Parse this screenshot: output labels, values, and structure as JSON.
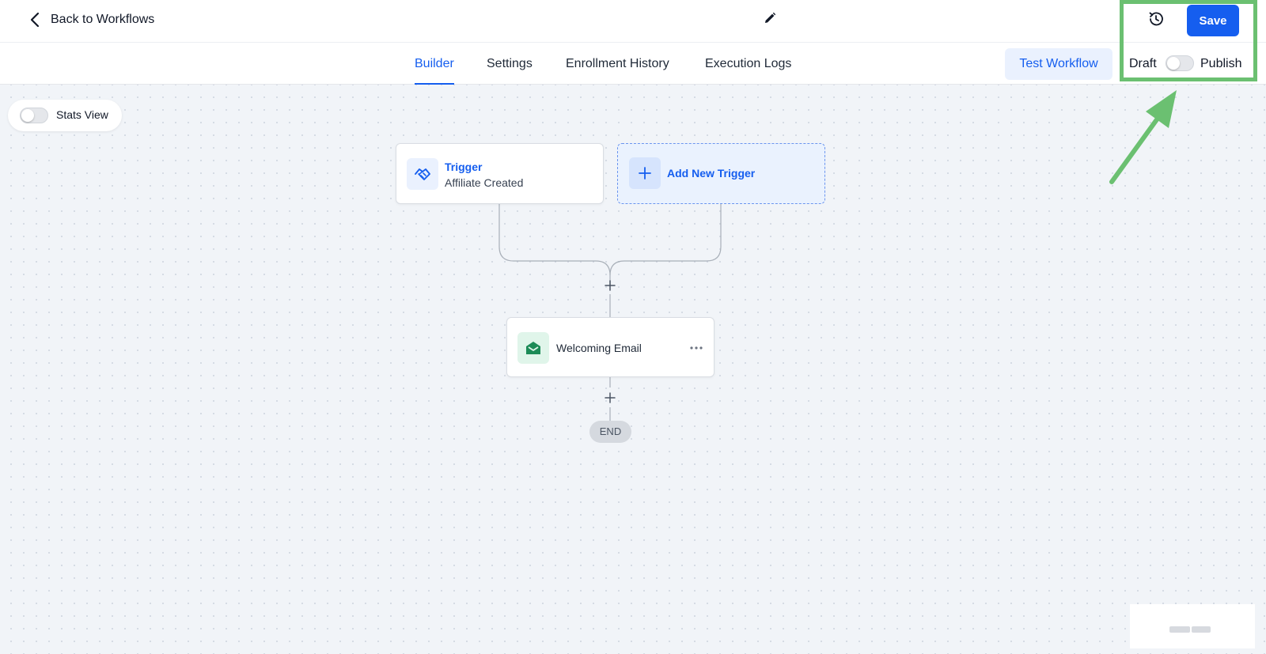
{
  "header": {
    "back_label": "Back to Workflows",
    "save_label": "Save"
  },
  "tabs": [
    {
      "label": "Builder",
      "active": true
    },
    {
      "label": "Settings",
      "active": false
    },
    {
      "label": "Enrollment History",
      "active": false
    },
    {
      "label": "Execution Logs",
      "active": false
    }
  ],
  "toolbar": {
    "test_label": "Test Workflow",
    "draft_label": "Draft",
    "publish_label": "Publish",
    "published": false
  },
  "canvas": {
    "stats_label": "Stats View",
    "stats_enabled": false,
    "trigger": {
      "title": "Trigger",
      "subtitle": "Affiliate Created",
      "icon": "affiliate-handshake-icon"
    },
    "add_trigger_label": "Add New Trigger",
    "steps": [
      {
        "label": "Welcoming Email",
        "icon": "email-open-icon"
      }
    ],
    "end_label": "END"
  },
  "colors": {
    "accent": "#155eef",
    "highlight": "#6bc071",
    "canvas_bg": "#f1f4f8"
  }
}
